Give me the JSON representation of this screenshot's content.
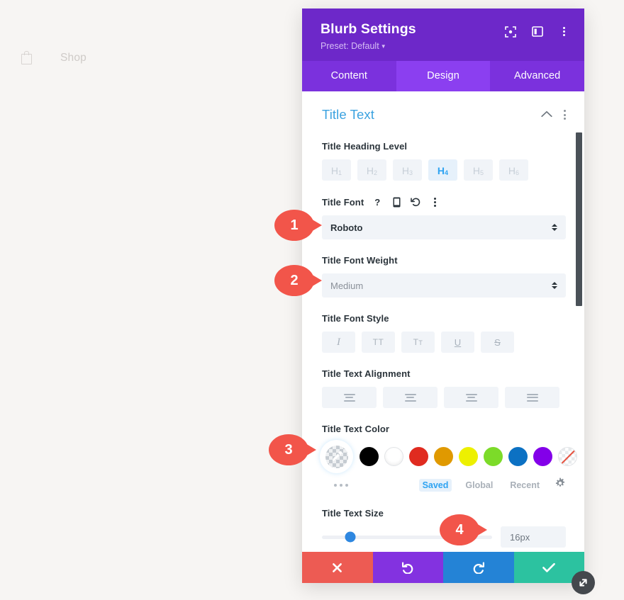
{
  "background": {
    "nav": {
      "shop_label": "Shop",
      "bag_icon": "shopping-bag-icon"
    }
  },
  "modal": {
    "title": "Blurb Settings",
    "preset_label": "Preset: Default",
    "header_icons": [
      "focus-frame-icon",
      "layout-panel-icon",
      "vertical-dots-icon"
    ],
    "tabs": [
      {
        "label": "Content",
        "active": false
      },
      {
        "label": "Design",
        "active": true
      },
      {
        "label": "Advanced",
        "active": false
      }
    ],
    "section": {
      "title": "Title Text",
      "collapse_icon": "chevron-up-icon",
      "options_icon": "vertical-dots-icon"
    },
    "fields": {
      "heading_level": {
        "label": "Title Heading Level",
        "options": [
          "H1",
          "H2",
          "H3",
          "H4",
          "H5",
          "H6"
        ],
        "selected": "H4"
      },
      "title_font": {
        "label": "Title Font",
        "icons": [
          "help-icon",
          "responsive-device-icon",
          "reset-icon",
          "vertical-dots-icon"
        ],
        "value": "Roboto"
      },
      "font_weight": {
        "label": "Title Font Weight",
        "value": "Medium"
      },
      "font_style": {
        "label": "Title Font Style",
        "buttons": [
          "italic-icon",
          "uppercase-icon",
          "smallcaps-icon",
          "underline-icon",
          "strikethrough-icon"
        ]
      },
      "text_alignment": {
        "label": "Title Text Alignment",
        "buttons": [
          "align-left-icon",
          "align-center-icon",
          "align-right-icon",
          "align-justify-icon"
        ]
      },
      "text_color": {
        "label": "Title Text Color",
        "eyedropper_icon": "eyedropper-icon",
        "more_colors_icon": "horizontal-dots-icon",
        "swatches": [
          {
            "name": "black",
            "hex": "#000000"
          },
          {
            "name": "white",
            "hex": "#ffffff"
          },
          {
            "name": "red",
            "hex": "#e02b20"
          },
          {
            "name": "orange",
            "hex": "#e09900"
          },
          {
            "name": "yellow",
            "hex": "#edf000"
          },
          {
            "name": "green",
            "hex": "#7cdb29"
          },
          {
            "name": "blue",
            "hex": "#0c71c3"
          },
          {
            "name": "purple",
            "hex": "#8300e9"
          },
          {
            "name": "none",
            "hex": "transparent"
          }
        ],
        "palette_tabs": [
          {
            "label": "Saved",
            "active": true
          },
          {
            "label": "Global",
            "active": false
          },
          {
            "label": "Recent",
            "active": false
          }
        ],
        "settings_icon": "gear-icon"
      },
      "text_size": {
        "label": "Title Text Size",
        "value": "16px",
        "slider_percent": 16.5
      }
    },
    "footer": [
      {
        "name": "cancel",
        "icon": "close-icon",
        "color": "#ed5b53"
      },
      {
        "name": "undo",
        "icon": "undo-icon",
        "color": "#8332e0"
      },
      {
        "name": "redo",
        "icon": "redo-icon",
        "color": "#2483d6"
      },
      {
        "name": "save",
        "icon": "check-icon",
        "color": "#2cc2a0"
      }
    ],
    "resize_handle_icon": "resize-diagonal-icon"
  },
  "callouts": [
    {
      "number": "1"
    },
    {
      "number": "2"
    },
    {
      "number": "3"
    },
    {
      "number": "4"
    }
  ],
  "colors": {
    "header_purple": "#6d28c9",
    "tab_purple": "#7b31dd",
    "tab_active_purple": "#8b3ff0",
    "section_blue": "#3ba2e0",
    "accent_blue": "#2ea3f2",
    "callout_red": "#f2554a",
    "page_bg": "#f7f5f3"
  }
}
